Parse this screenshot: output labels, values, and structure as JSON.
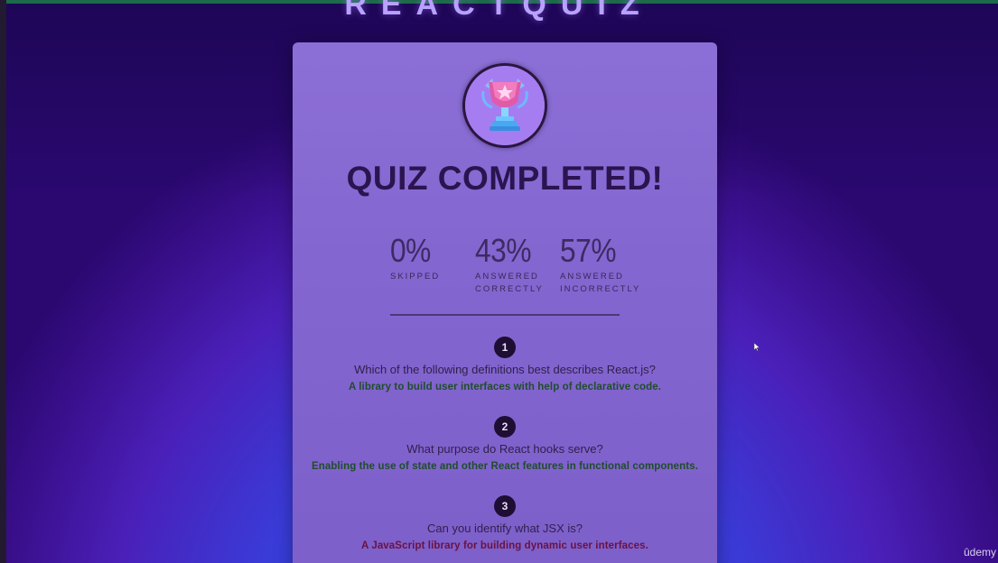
{
  "header": {
    "logo_text": "REACTQUIZ"
  },
  "summary": {
    "title": "QUIZ COMPLETED!",
    "trophy_icon": "trophy-icon",
    "stats": [
      {
        "value": "0%",
        "label": "SKIPPED"
      },
      {
        "value": "43%",
        "label": "ANSWERED\nCORRECTLY"
      },
      {
        "value": "57%",
        "label": "ANSWERED\nINCORRECTLY"
      }
    ],
    "answers": [
      {
        "number": "1",
        "question": "Which of the following definitions best describes React.js?",
        "user_answer": "A library to build user interfaces with help of declarative code.",
        "status": "correct"
      },
      {
        "number": "2",
        "question": "What purpose do React hooks serve?",
        "user_answer": "Enabling the use of state and other React features in functional components.",
        "status": "correct"
      },
      {
        "number": "3",
        "question": "Can you identify what JSX is?",
        "user_answer": "A JavaScript library for building dynamic user interfaces.",
        "status": "wrong"
      }
    ]
  },
  "watermark": {
    "text": "ûdemy"
  },
  "colors": {
    "correct": "#1f4e2a",
    "wrong": "#6a1240",
    "card": "#8466d0",
    "title": "#2c1450"
  }
}
